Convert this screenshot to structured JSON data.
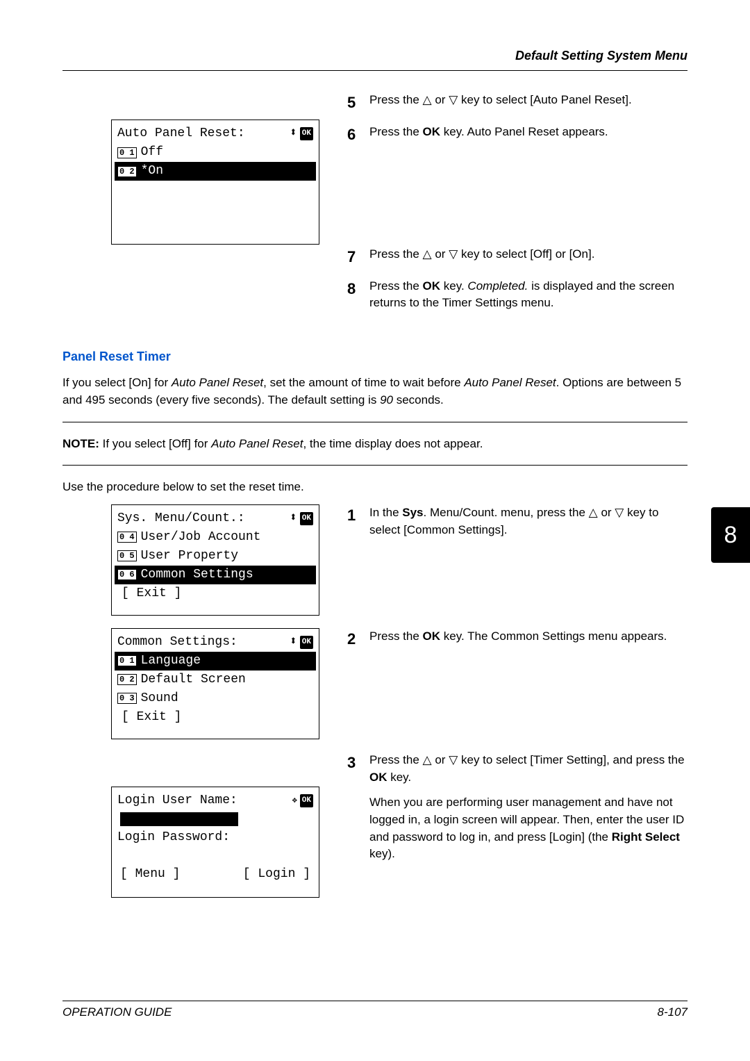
{
  "header": {
    "running": "Default Setting System Menu"
  },
  "tab": {
    "number": "8"
  },
  "footer": {
    "left": "OPERATION GUIDE",
    "right": "8-107"
  },
  "lcd1": {
    "title": "Auto Panel Reset:",
    "opt1_num": "0 1",
    "opt1": "Off",
    "opt2_num": "0 2",
    "opt2": "*On"
  },
  "lcd2": {
    "title": "Sys. Menu/Count.:",
    "r1_num": "0 4",
    "r1": "User/Job Account",
    "r2_num": "0 5",
    "r2": "User Property",
    "r3_num": "0 6",
    "r3": "Common Settings",
    "softR": "[ Exit   ]"
  },
  "lcd3": {
    "title": "Common Settings:",
    "r1_num": "0 1",
    "r1": "Language",
    "r2_num": "0 2",
    "r2": "Default Screen",
    "r3_num": "0 3",
    "r3": "Sound",
    "softR": "[ Exit   ]"
  },
  "lcd4": {
    "title": "Login User Name:",
    "pwd": "Login Password:",
    "softL": "[ Menu   ]",
    "softR": "[ Login  ]"
  },
  "steps_top": {
    "s5_a": "Press the ",
    "s5_b": " or ",
    "s5_c": " key to select [Auto Panel Reset].",
    "s6_a": "Press the ",
    "s6_b": "OK",
    "s6_c": " key. Auto Panel Reset appears.",
    "s7_a": "Press the ",
    "s7_b": " or ",
    "s7_c": " key to select [Off] or [On].",
    "s8_a": "Press the ",
    "s8_b": "OK",
    "s8_c": " key. ",
    "s8_d": "Completed.",
    "s8_e": " is displayed and the screen returns to the Timer Settings menu."
  },
  "section": {
    "heading": "Panel Reset Timer",
    "p1_a": "If you select [On] for ",
    "p1_b": "Auto Panel Reset",
    "p1_c": ", set the amount of time to wait before ",
    "p1_d": "Auto Panel Reset",
    "p1_e": ". Options are between 5 and 495 seconds (every five seconds). The default setting is ",
    "p1_f": "90",
    "p1_g": " seconds.",
    "note_a": "NOTE:",
    "note_b": " If you select [Off] for ",
    "note_c": "Auto Panel Reset",
    "note_d": ", the time display does not appear.",
    "p2": "Use the procedure below to set the reset time."
  },
  "steps_bottom": {
    "s1_a": "In the ",
    "s1_b": "Sys",
    "s1_c": ". Menu/Count. menu, press the ",
    "s1_d": " or ",
    "s1_e": " key to select [Common Settings].",
    "s2_a": "Press the ",
    "s2_b": "OK",
    "s2_c": " key. The Common Settings menu appears.",
    "s3_a": "Press the ",
    "s3_b": " or ",
    "s3_c": " key to select [Timer Setting], and press the ",
    "s3_d": "OK",
    "s3_e": " key.",
    "s3_p2_a": "When you are performing user management and have not logged in, a login screen will appear. Then, enter the user ID and password to log in, and press [Login] (the ",
    "s3_p2_b": "Right Select",
    "s3_p2_c": " key)."
  }
}
